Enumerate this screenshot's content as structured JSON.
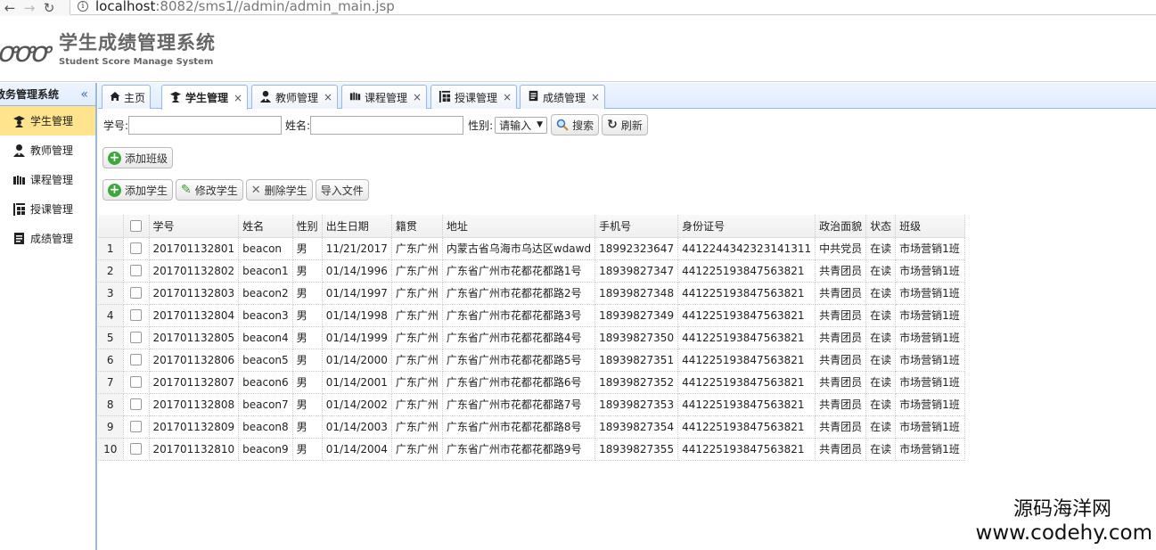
{
  "browser": {
    "url_host": "localhost",
    "url_path": ":8082/sms1//admin/admin_main.jsp"
  },
  "header": {
    "logo_mark": "ꝍ",
    "title_cn": "学生成绩管理系统",
    "title_en": "Student Score Manage System"
  },
  "sidebar": {
    "title": "教务管理系统",
    "items": [
      {
        "label": "学生管理",
        "icon": "student-icon",
        "active": true
      },
      {
        "label": "教师管理",
        "icon": "teacher-icon",
        "active": false
      },
      {
        "label": "课程管理",
        "icon": "course-icon",
        "active": false
      },
      {
        "label": "授课管理",
        "icon": "teaching-icon",
        "active": false
      },
      {
        "label": "成绩管理",
        "icon": "score-icon",
        "active": false
      }
    ]
  },
  "tabs": [
    {
      "label": "主页",
      "icon": "home-icon",
      "closable": false
    },
    {
      "label": "学生管理",
      "icon": "student-icon",
      "closable": true,
      "active": true
    },
    {
      "label": "教师管理",
      "icon": "teacher-icon",
      "closable": true
    },
    {
      "label": "课程管理",
      "icon": "course-icon",
      "closable": true
    },
    {
      "label": "授课管理",
      "icon": "teaching-icon",
      "closable": true
    },
    {
      "label": "成绩管理",
      "icon": "score-icon",
      "closable": true
    }
  ],
  "search": {
    "id_label": "学号:",
    "name_label": "姓名:",
    "gender_label": "性别:",
    "gender_value": "请输入",
    "search_button": "搜索",
    "refresh_button": "刷新"
  },
  "toolbar": {
    "add_class": "添加班级",
    "add_student": "添加学生",
    "edit_student": "修改学生",
    "delete_student": "删除学生",
    "import_file": "导入文件"
  },
  "table": {
    "columns": [
      "学号",
      "姓名",
      "性别",
      "出生日期",
      "籍贯",
      "地址",
      "手机号",
      "身份证号",
      "政治面貌",
      "状态",
      "班级"
    ],
    "rows": [
      [
        "1",
        "201701132801",
        "beacon",
        "男",
        "11/21/2017",
        "广东广州",
        "内蒙古省乌海市乌达区wdawd",
        "18992323647",
        "441224434232314131​1",
        "中共党员",
        "在读",
        "市场营销1班"
      ],
      [
        "2",
        "201701132802",
        "beacon1",
        "男",
        "01/14/1996",
        "广东广州",
        "广东省广州市花都花都路1号",
        "18939827347",
        "441225193847563821",
        "共青团员",
        "在读",
        "市场营销1班"
      ],
      [
        "3",
        "201701132803",
        "beacon2",
        "男",
        "01/14/1997",
        "广东广州",
        "广东省广州市花都花都路2号",
        "18939827348",
        "441225193847563821",
        "共青团员",
        "在读",
        "市场营销1班"
      ],
      [
        "4",
        "201701132804",
        "beacon3",
        "男",
        "01/14/1998",
        "广东广州",
        "广东省广州市花都花都路3号",
        "18939827349",
        "441225193847563821",
        "共青团员",
        "在读",
        "市场营销1班"
      ],
      [
        "5",
        "201701132805",
        "beacon4",
        "男",
        "01/14/1999",
        "广东广州",
        "广东省广州市花都花都路4号",
        "18939827350",
        "441225193847563821",
        "共青团员",
        "在读",
        "市场营销1班"
      ],
      [
        "6",
        "201701132806",
        "beacon5",
        "男",
        "01/14/2000",
        "广东广州",
        "广东省广州市花都花都路5号",
        "18939827351",
        "441225193847563821",
        "共青团员",
        "在读",
        "市场营销1班"
      ],
      [
        "7",
        "201701132807",
        "beacon6",
        "男",
        "01/14/2001",
        "广东广州",
        "广东省广州市花都花都路6号",
        "18939827352",
        "441225193847563821",
        "共青团员",
        "在读",
        "市场营销1班"
      ],
      [
        "8",
        "201701132808",
        "beacon7",
        "男",
        "01/14/2002",
        "广东广州",
        "广东省广州市花都花都路7号",
        "18939827353",
        "441225193847563821",
        "共青团员",
        "在读",
        "市场营销1班"
      ],
      [
        "9",
        "201701132809",
        "beacon8",
        "男",
        "01/14/2003",
        "广东广州",
        "广东省广州市花都花都路8号",
        "18939827354",
        "441225193847563821",
        "共青团员",
        "在读",
        "市场营销1班"
      ],
      [
        "10",
        "201701132810",
        "beacon9",
        "男",
        "01/14/2004",
        "广东广州",
        "广东省广州市花都花都路9号",
        "18939827355",
        "441225193847563821",
        "共青团员",
        "在读",
        "市场营销1班"
      ]
    ]
  },
  "watermark": {
    "line1": "源码海洋网",
    "line2": "www.codehy.com"
  }
}
